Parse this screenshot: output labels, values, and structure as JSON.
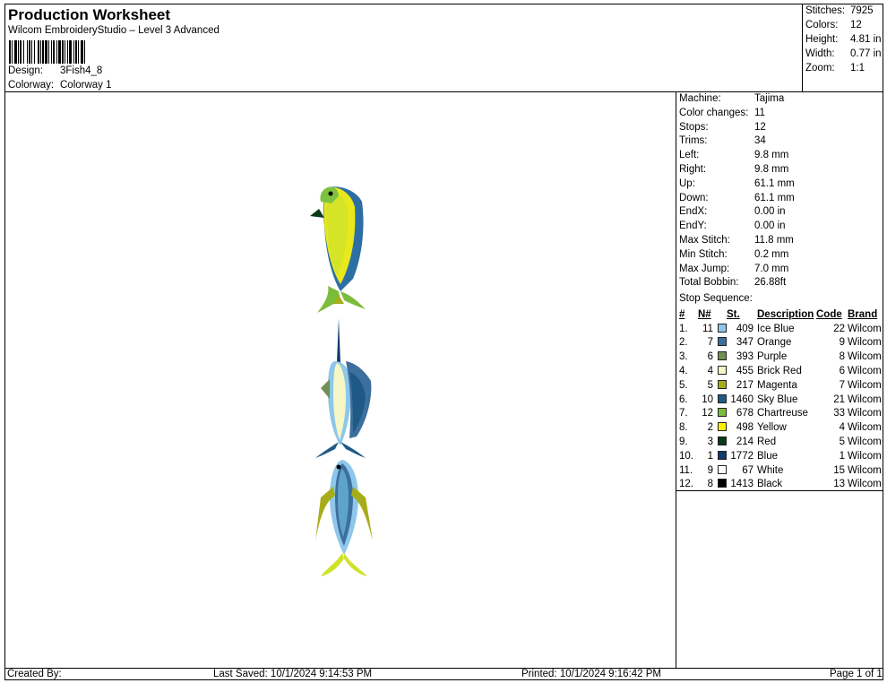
{
  "header": {
    "title": "Production Worksheet",
    "subtitle": "Wilcom EmbroideryStudio – Level 3 Advanced",
    "design_label": "Design:",
    "design_value": "3Fish4_8",
    "colorway_label": "Colorway:",
    "colorway_value": "Colorway 1"
  },
  "summary": {
    "stitches_label": "Stitches:",
    "stitches": "7925",
    "colors_label": "Colors:",
    "colors": "12",
    "height_label": "Height:",
    "height": "4.81 in",
    "width_label": "Width:",
    "width": "0.77 in",
    "zoom_label": "Zoom:",
    "zoom": "1:1"
  },
  "machine_info": [
    {
      "label": "Machine:",
      "value": "Tajima"
    },
    {
      "label": "Color changes:",
      "value": "11"
    },
    {
      "label": "Stops:",
      "value": "12"
    },
    {
      "label": "Trims:",
      "value": "34"
    },
    {
      "label": "Left:",
      "value": "9.8 mm"
    },
    {
      "label": "Right:",
      "value": "9.8 mm"
    },
    {
      "label": "Up:",
      "value": "61.1 mm"
    },
    {
      "label": "Down:",
      "value": "61.1 mm"
    },
    {
      "label": "EndX:",
      "value": "0.00 in"
    },
    {
      "label": "EndY:",
      "value": "0.00 in"
    },
    {
      "label": "Max Stitch:",
      "value": "11.8 mm"
    },
    {
      "label": "Min Stitch:",
      "value": "0.2 mm"
    },
    {
      "label": "Max Jump:",
      "value": "7.0 mm"
    },
    {
      "label": "Total Bobbin:",
      "value": "26.88ft"
    }
  ],
  "stop_sequence": {
    "title": "Stop Sequence:",
    "headers": {
      "idx": "#",
      "n": "N#",
      "st": "St.",
      "desc": "Description",
      "code": "Code",
      "brand": "Brand"
    },
    "rows": [
      {
        "idx": "1.",
        "n": "11",
        "color": "#8ec7ea",
        "st": "409",
        "desc": "Ice Blue",
        "code": "22",
        "brand": "Wilcom"
      },
      {
        "idx": "2.",
        "n": "7",
        "color": "#3d6f9e",
        "st": "347",
        "desc": "Orange",
        "code": "9",
        "brand": "Wilcom"
      },
      {
        "idx": "3.",
        "n": "6",
        "color": "#6f8f55",
        "st": "393",
        "desc": "Purple",
        "code": "8",
        "brand": "Wilcom"
      },
      {
        "idx": "4.",
        "n": "4",
        "color": "#f5f8c6",
        "st": "455",
        "desc": "Brick Red",
        "code": "6",
        "brand": "Wilcom"
      },
      {
        "idx": "5.",
        "n": "5",
        "color": "#a7ad18",
        "st": "217",
        "desc": "Magenta",
        "code": "7",
        "brand": "Wilcom"
      },
      {
        "idx": "6.",
        "n": "10",
        "color": "#1f5a86",
        "st": "1460",
        "desc": "Sky Blue",
        "code": "21",
        "brand": "Wilcom"
      },
      {
        "idx": "7.",
        "n": "12",
        "color": "#7cbc3c",
        "st": "678",
        "desc": "Chartreuse",
        "code": "33",
        "brand": "Wilcom"
      },
      {
        "idx": "8.",
        "n": "2",
        "color": "#fff200",
        "st": "498",
        "desc": "Yellow",
        "code": "4",
        "brand": "Wilcom"
      },
      {
        "idx": "9.",
        "n": "3",
        "color": "#0b3a18",
        "st": "214",
        "desc": "Red",
        "code": "5",
        "brand": "Wilcom"
      },
      {
        "idx": "10.",
        "n": "1",
        "color": "#0e3a6d",
        "st": "1772",
        "desc": "Blue",
        "code": "1",
        "brand": "Wilcom"
      },
      {
        "idx": "11.",
        "n": "9",
        "color": "#ffffff",
        "st": "67",
        "desc": "White",
        "code": "15",
        "brand": "Wilcom"
      },
      {
        "idx": "12.",
        "n": "8",
        "color": "#000000",
        "st": "1413",
        "desc": "Black",
        "code": "13",
        "brand": "Wilcom"
      }
    ]
  },
  "footer": {
    "created_by": "Created By:",
    "last_saved": "Last Saved: 10/1/2024 9:14:53 PM",
    "printed": "Printed: 10/1/2024 9:16:42 PM",
    "page": "Page 1 of 1"
  }
}
